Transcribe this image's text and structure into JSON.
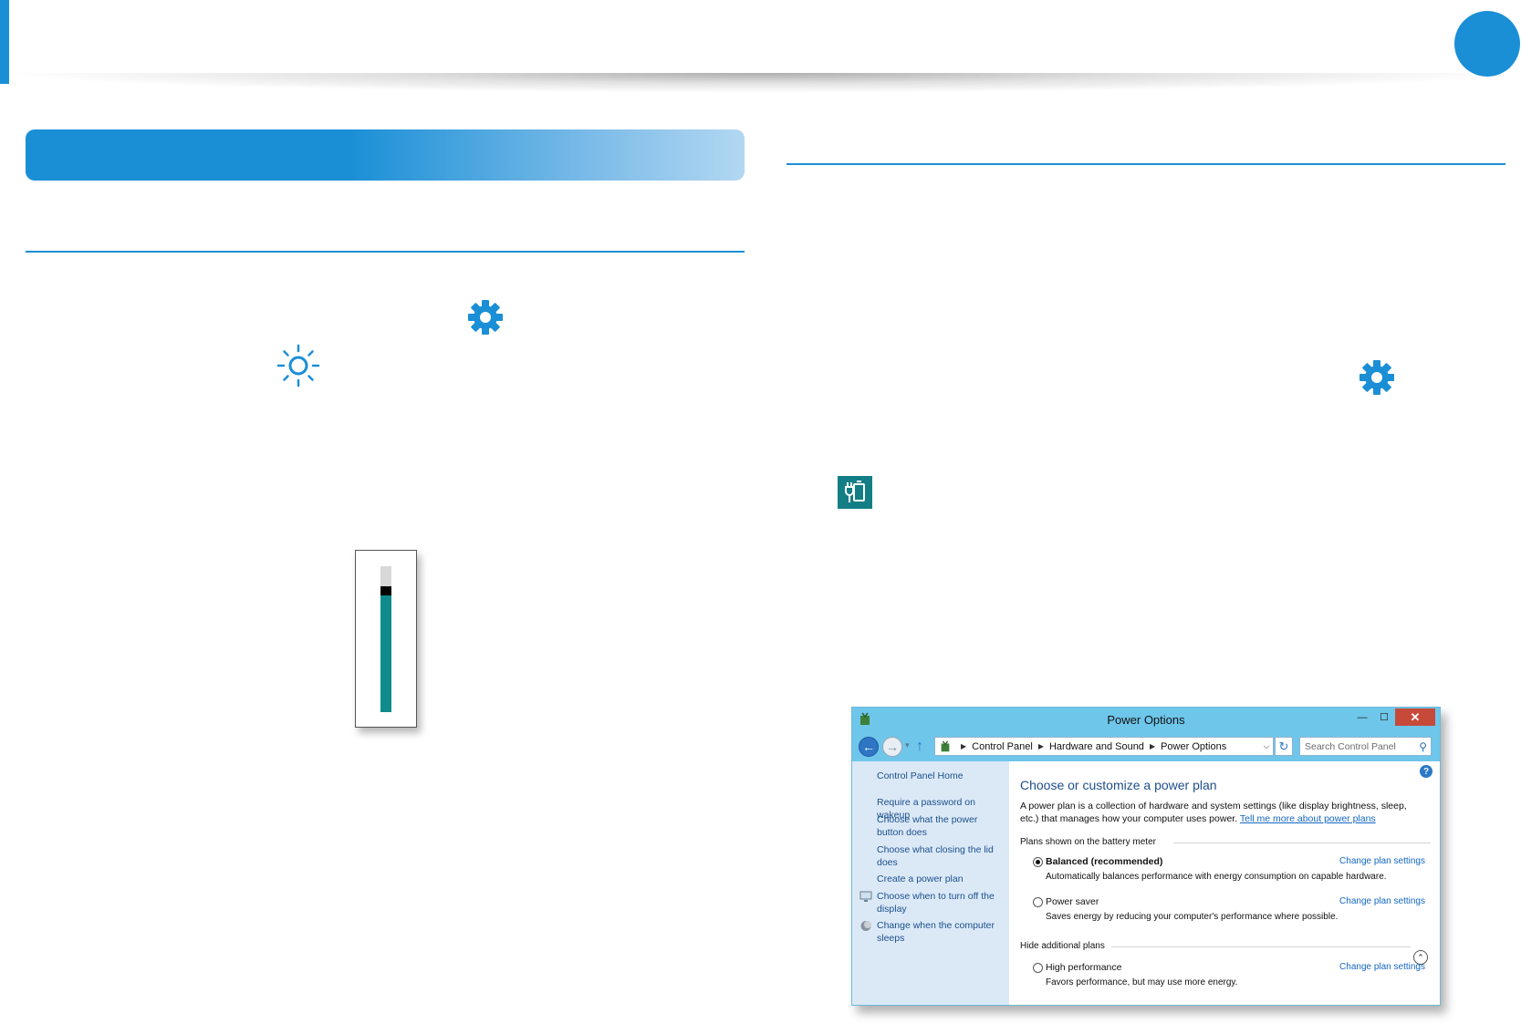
{
  "colors": {
    "accent": "#1a8fd6",
    "teal": "#0f8b8d",
    "link": "#1467c2",
    "window_title_bar": "#6ec6ea"
  },
  "icons": {
    "settings": "gear-icon",
    "brightness": "sun-icon",
    "battery": "battery-plug-icon"
  },
  "brightness_slider": {
    "level_fraction": 0.8
  },
  "power_options_window": {
    "title": "Power Options",
    "controls": {
      "minimize": "—",
      "maximize": "☐",
      "close": "✕"
    },
    "address": {
      "crumbs": [
        "Control Panel",
        "Hardware and Sound",
        "Power Options"
      ],
      "search_placeholder": "Search Control Panel"
    },
    "sidebar": {
      "home": "Control Panel Home",
      "links": [
        "Require a password on wakeup",
        "Choose what the power button does",
        "Choose what closing the lid does",
        "Create a power plan",
        "Choose when to turn off the display",
        "Change when the computer sleeps"
      ]
    },
    "main": {
      "heading": "Choose or customize a power plan",
      "description": "A power plan is a collection of hardware and system settings (like display brightness, sleep, etc.) that manages how your computer uses power.",
      "learn_more": "Tell me more about power plans",
      "group_battery": "Plans shown on the battery meter",
      "group_hidden": "Hide additional plans",
      "change_link": "Change plan settings",
      "plans": [
        {
          "name": "Balanced (recommended)",
          "desc": "Automatically balances performance with energy consumption on capable hardware.",
          "selected": true
        },
        {
          "name": "Power saver",
          "desc": "Saves energy by reducing your computer's performance where possible.",
          "selected": false
        },
        {
          "name": "High performance",
          "desc": "Favors performance, but may use more energy.",
          "selected": false
        }
      ]
    }
  }
}
